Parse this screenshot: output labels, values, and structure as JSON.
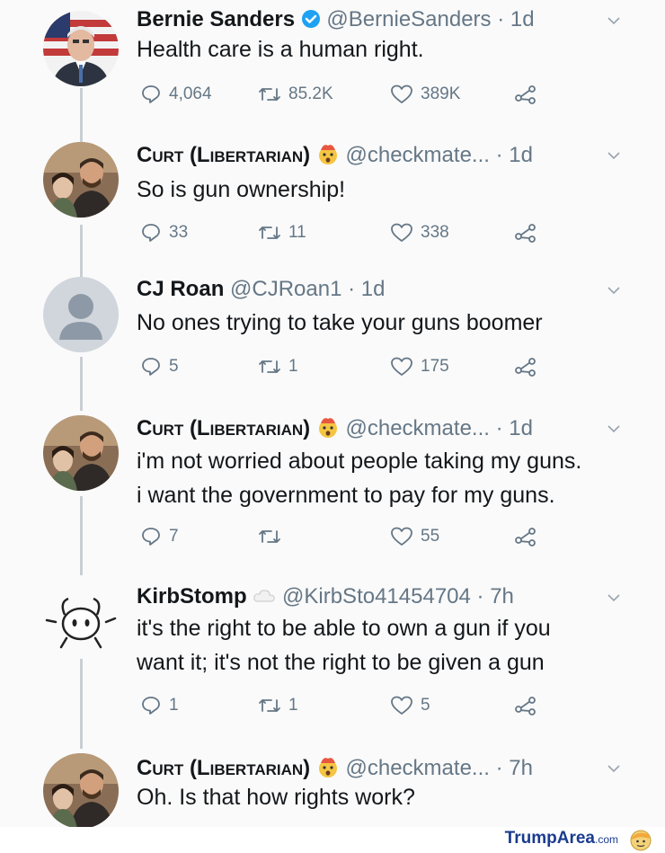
{
  "tweets": [
    {
      "name": "Bernie Sanders",
      "handle": "@BernieSanders",
      "time": "· 1d",
      "verified": true,
      "lines": [
        "Health care is a human right."
      ],
      "replies": "4,064",
      "retweets": "85.2K",
      "likes": "389K"
    },
    {
      "name": "Curt (Libertarian)",
      "handle": "@checkmate...",
      "time": "· 1d",
      "lines": [
        "So is gun ownership!"
      ],
      "replies": "33",
      "retweets": "11",
      "likes": "338"
    },
    {
      "name": "CJ Roan",
      "handle": "@CJRoan1",
      "time": "· 1d",
      "lines": [
        "No ones trying to take your guns boomer"
      ],
      "replies": "5",
      "retweets": "1",
      "likes": "175"
    },
    {
      "name": "Curt (Libertarian)",
      "handle": "@checkmate...",
      "time": "· 1d",
      "lines": [
        "i'm not worried about people taking my guns.",
        "i want the government to pay for my guns."
      ],
      "replies": "7",
      "retweets": "",
      "likes": "55"
    },
    {
      "name": "KirbStomp",
      "handle": "@KirbSto41454704",
      "time": "· 7h",
      "lines": [
        "it's the right to be able to own a gun if you",
        "want it; it's not the right to be given a gun"
      ],
      "replies": "1",
      "retweets": "1",
      "likes": "5"
    },
    {
      "name": "Curt (Libertarian)",
      "handle": "@checkmate...",
      "time": "· 7h",
      "lines": [
        "Oh. Is that how rights work?"
      ]
    }
  ],
  "icons": {
    "reply": "reply-icon",
    "retweet": "retweet-icon",
    "like": "heart-icon",
    "share": "share-icon",
    "chevron": "chevron-down-icon",
    "verified": "verified-badge-icon",
    "emoji": "exploding-head-emoji-icon"
  },
  "footer": {
    "brand": "TrumpArea",
    "domain": ".com"
  },
  "colors": {
    "text": "#14171a",
    "muted": "#657786",
    "verified": "#1da1f2",
    "brand": "#1a3c8f"
  }
}
